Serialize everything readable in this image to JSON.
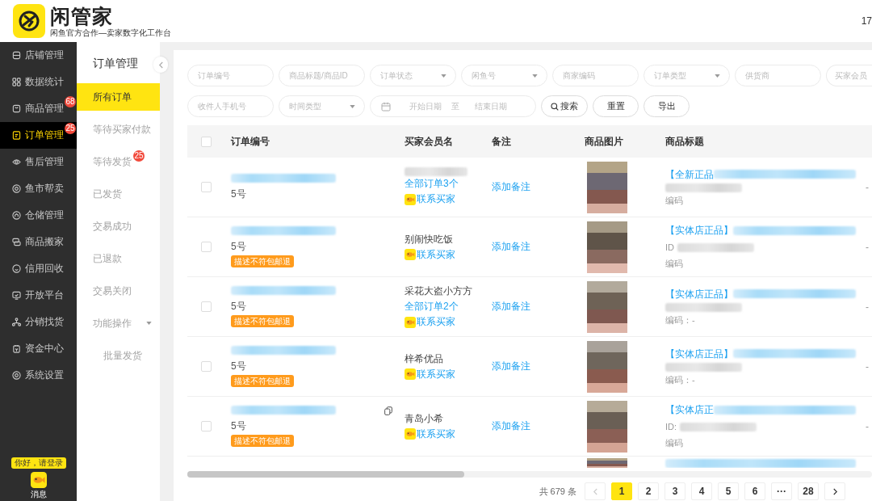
{
  "header": {
    "title": "闲管家",
    "subtitle": "闲鱼官方合作—卖家数字化工作台",
    "account": "17"
  },
  "nav": {
    "items": [
      {
        "label": "店铺管理",
        "selected": false
      },
      {
        "label": "数据统计",
        "selected": false
      },
      {
        "label": "商品管理",
        "selected": false,
        "badge": "68"
      },
      {
        "label": "订单管理",
        "selected": true,
        "badge": "25"
      },
      {
        "label": "售后管理",
        "selected": false
      },
      {
        "label": "鱼市帮卖",
        "selected": false
      },
      {
        "label": "仓储管理",
        "selected": false
      },
      {
        "label": "商品搬家",
        "selected": false
      },
      {
        "label": "信用回收",
        "selected": false
      },
      {
        "label": "开放平台",
        "selected": false
      },
      {
        "label": "分销找货",
        "selected": false
      },
      {
        "label": "资金中心",
        "selected": false
      },
      {
        "label": "系统设置",
        "selected": false
      }
    ],
    "login_tip": "你好，请登录",
    "message_label": "消息"
  },
  "subnav": {
    "title": "订单管理",
    "items": [
      {
        "label": "所有订单",
        "selected": true
      },
      {
        "label": "等待买家付款",
        "selected": false
      },
      {
        "label": "等待发货",
        "selected": false,
        "badge": "25"
      },
      {
        "label": "已发货",
        "selected": false
      },
      {
        "label": "交易成功",
        "selected": false
      },
      {
        "label": "已退款",
        "selected": false
      },
      {
        "label": "交易关闭",
        "selected": false
      },
      {
        "label": "功能操作",
        "selected": false,
        "expanded": true,
        "children": [
          {
            "label": "批量发货",
            "selected": false
          }
        ]
      }
    ]
  },
  "filters": {
    "rows": [
      {
        "fields": [
          {
            "kind": "text",
            "placeholder": "订单编号"
          },
          {
            "kind": "text",
            "placeholder": "商品标题/商品ID"
          },
          {
            "kind": "select",
            "placeholder": "订单状态"
          },
          {
            "kind": "select",
            "placeholder": "闲鱼号"
          },
          {
            "kind": "text",
            "placeholder": "商家编码"
          },
          {
            "kind": "select",
            "placeholder": "订单类型"
          },
          {
            "kind": "text",
            "placeholder": "供货商"
          },
          {
            "kind": "text",
            "placeholder": "买家会员"
          }
        ]
      },
      {
        "fields": [
          {
            "kind": "text",
            "placeholder": "收件人手机号"
          },
          {
            "kind": "select",
            "placeholder": "时间类型"
          },
          {
            "kind": "date_range",
            "start_placeholder": "开始日期",
            "separator": "至",
            "end_placeholder": "结束日期"
          }
        ],
        "buttons": [
          {
            "kind": "search",
            "label": "搜索"
          },
          {
            "kind": "plain",
            "label": "重置"
          },
          {
            "kind": "plain",
            "label": "导出"
          }
        ]
      }
    ]
  },
  "table": {
    "header_checked": false,
    "columns": [
      "订单编号",
      "买家会员名",
      "备注",
      "商品图片",
      "商品标题"
    ],
    "rows": [
      {
        "kind": "full",
        "checked": false,
        "order_note": "5号",
        "copy_icon": false,
        "orders_link": "全部订单3个",
        "contact": "联系买家",
        "remark": "添加备注",
        "title_prefix": "【全新正品",
        "code": "编码",
        "column_7": "-"
      },
      {
        "kind": "full",
        "checked": false,
        "order_note": "5号",
        "tag": "描述不符包邮退",
        "copy_icon": false,
        "buyer_name": "别闹快吃饭",
        "contact": "联系买家",
        "remark": "添加备注",
        "title_prefix": "【实体店正品】",
        "id_label": "ID",
        "code": "编码",
        "column_7": "-"
      },
      {
        "kind": "full",
        "checked": false,
        "order_note": "5号",
        "tag": "描述不符包邮退",
        "copy_icon": false,
        "buyer_name": "采花大盗小方方",
        "orders_link": "全部订单2个",
        "contact": "联系买家",
        "remark": "添加备注",
        "title_prefix": "【实体店正品】",
        "code": "编码：-",
        "column_7": "-"
      },
      {
        "kind": "full",
        "checked": false,
        "order_note": "5号",
        "tag": "描述不符包邮退",
        "copy_icon": false,
        "buyer_name": "梓希优品",
        "contact": "联系买家",
        "remark": "添加备注",
        "title_prefix": "【实体店正品】",
        "code": "编码：-",
        "column_7": "-"
      },
      {
        "kind": "full",
        "checked": false,
        "order_note": "5号",
        "tag": "描述不符包邮退",
        "copy_icon": true,
        "buyer_name": "青岛小希",
        "contact": "联系买家",
        "remark": "添加备注",
        "title_prefix": "【实体店正",
        "id_label": "ID:",
        "code": "编码",
        "column_7": "-"
      },
      {
        "kind": "cut"
      }
    ]
  },
  "pagination": {
    "total": "共 679 条",
    "prev_disabled": true,
    "pages": [
      {
        "label": "1",
        "selected": true
      },
      {
        "label": "2",
        "selected": false
      },
      {
        "label": "3",
        "selected": false
      },
      {
        "label": "4",
        "selected": false
      },
      {
        "label": "5",
        "selected": false
      },
      {
        "label": "6",
        "selected": false
      },
      {
        "label": "···",
        "selected": false
      },
      {
        "label": "28",
        "selected": false
      }
    ],
    "next_disabled": false
  }
}
